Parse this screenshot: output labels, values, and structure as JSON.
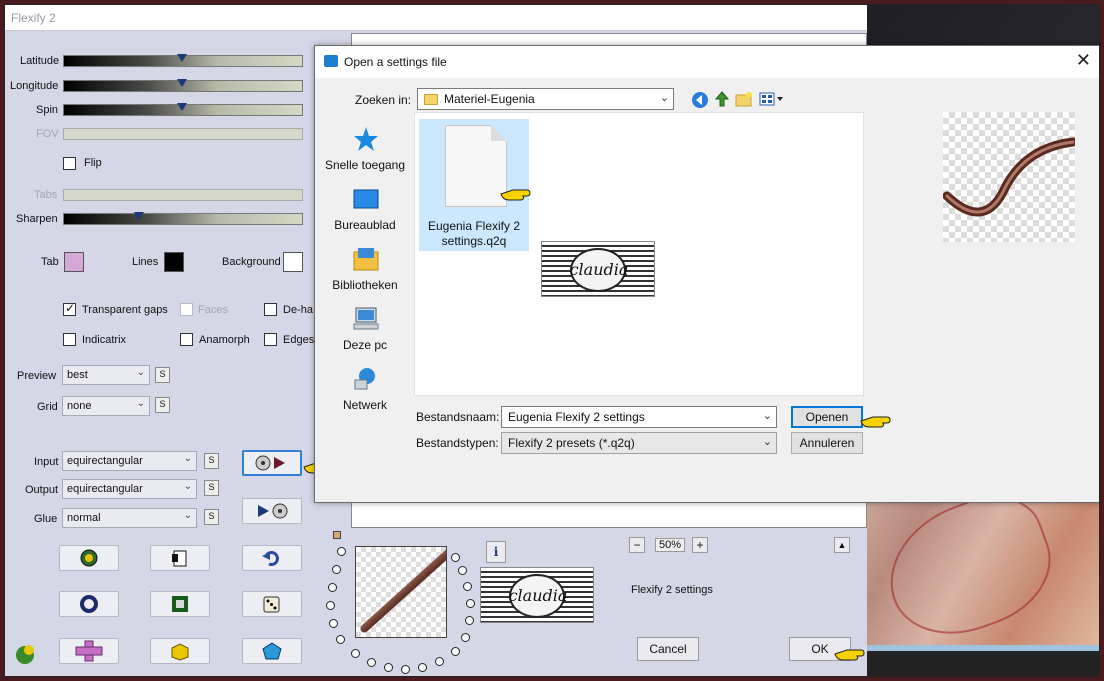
{
  "app": {
    "title": "Flexify 2"
  },
  "sliders": {
    "latitude": "Latitude",
    "longitude": "Longitude",
    "spin": "Spin",
    "fov": "FOV",
    "tabs": "Tabs",
    "sharpen": "Sharpen",
    "flip": "Flip"
  },
  "colors": {
    "tab_label": "Tab",
    "lines_label": "Lines",
    "background_label": "Background",
    "tab_color": "#d6a8d8",
    "lines_color": "#000000",
    "background_color": "#ffffff"
  },
  "options": {
    "transparent_gaps": "Transparent gaps",
    "faces": "Faces",
    "dehalo": "De-ha",
    "indicatrix": "Indicatrix",
    "anamorph": "Anamorph",
    "edges": "Edges"
  },
  "fields": {
    "preview_label": "Preview",
    "preview_value": "best",
    "grid_label": "Grid",
    "grid_value": "none",
    "input_label": "Input",
    "input_value": "equirectangular",
    "output_label": "Output",
    "output_value": "equirectangular",
    "glue_label": "Glue",
    "glue_value": "normal",
    "s": "S"
  },
  "bottom": {
    "zoom_minus": "−",
    "zoom_value": "50%",
    "zoom_plus": "+",
    "info": "i",
    "preset_name": "Flexify 2 settings",
    "cancel": "Cancel",
    "ok": "OK",
    "up": "▲"
  },
  "dialog": {
    "title": "Open a settings file",
    "close": "✕",
    "zoeken_label": "Zoeken in:",
    "folder": "Materiel-Eugenia",
    "places": [
      "Snelle toegang",
      "Bureaublad",
      "Bibliotheken",
      "Deze pc",
      "Netwerk"
    ],
    "file_line1": "Eugenia Flexify 2",
    "file_line2": "settings.q2q",
    "watermark": "claudia",
    "filename_label": "Bestandsnaam:",
    "filename_value": "Eugenia Flexify 2 settings",
    "filetype_label": "Bestandstypen:",
    "filetype_value": "Flexify 2 presets (*.q2q)",
    "open": "Openen",
    "cancel": "Annuleren"
  },
  "accent_colors": {
    "dialog_default_border": "#0078d7",
    "selected_item": "#cce8ff"
  }
}
